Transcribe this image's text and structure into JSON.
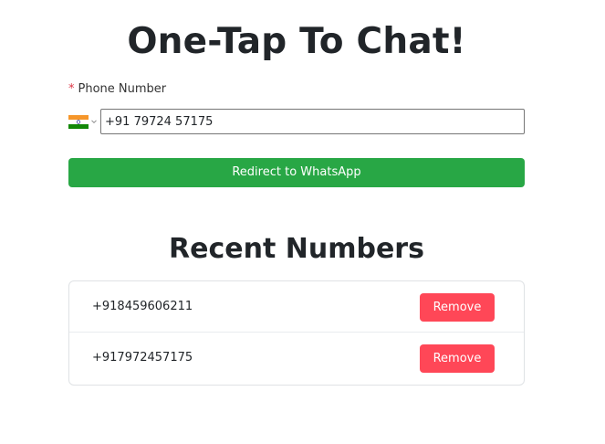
{
  "header": {
    "title": "One-Tap To Chat!"
  },
  "form": {
    "required_marker": "*",
    "phone_label": "Phone Number",
    "country_flag_icon": "india-flag-icon",
    "phone_value": "+91 79724 57175",
    "submit_label": "Redirect to WhatsApp"
  },
  "recent": {
    "title": "Recent Numbers",
    "items": [
      {
        "number": "+918459606211",
        "action_label": "Remove"
      },
      {
        "number": "+917972457175",
        "action_label": "Remove"
      }
    ]
  },
  "colors": {
    "primary_green": "#28a745",
    "remove_red": "#ff4757",
    "required_red": "#dc3545"
  }
}
